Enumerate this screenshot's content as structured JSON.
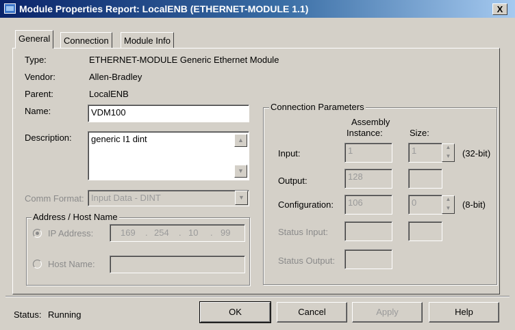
{
  "window": {
    "title": "Module Properties Report: LocalENB (ETHERNET-MODULE 1.1)",
    "close_label": "X"
  },
  "tabs": [
    {
      "label": "General"
    },
    {
      "label": "Connection"
    },
    {
      "label": "Module Info"
    }
  ],
  "general": {
    "type_label": "Type:",
    "type_value": "ETHERNET-MODULE Generic Ethernet Module",
    "vendor_label": "Vendor:",
    "vendor_value": "Allen-Bradley",
    "parent_label": "Parent:",
    "parent_value": "LocalENB",
    "name_label": "Name:",
    "name_value": "VDM100",
    "description_label": "Description:",
    "description_value": "generic I1 dint",
    "comm_format_label": "Comm Format:",
    "comm_format_value": "Input Data - DINT"
  },
  "address": {
    "group_label": "Address / Host Name",
    "ip_label": "IP Address:",
    "ip_octets": [
      "169",
      "254",
      "10",
      "99"
    ],
    "ip_dot": ".",
    "host_label": "Host Name:",
    "host_value": ""
  },
  "connection_params": {
    "group_label": "Connection Parameters",
    "col_assembly": "Assembly\nInstance:",
    "col_assembly_line1": "Assembly",
    "col_assembly_line2": "Instance:",
    "col_size": "Size:",
    "rows": [
      {
        "label": "Input:",
        "instance": "1",
        "size": "1",
        "unit": "(32-bit)"
      },
      {
        "label": "Output:",
        "instance": "128",
        "size": "",
        "unit": ""
      },
      {
        "label": "Configuration:",
        "instance": "106",
        "size": "0",
        "unit": "(8-bit)"
      },
      {
        "label": "Status Input:",
        "instance": "",
        "size": "",
        "unit": ""
      },
      {
        "label": "Status Output:",
        "instance": "",
        "size": "",
        "unit": ""
      }
    ]
  },
  "footer": {
    "status_label": "Status:",
    "status_value": "Running",
    "ok": "OK",
    "cancel": "Cancel",
    "apply": "Apply",
    "help": "Help"
  },
  "icons": {
    "title_icon": "window-icon",
    "spin_up": "arrow-up-icon",
    "spin_down": "arrow-down-icon",
    "dropdown": "chevron-down-icon"
  }
}
